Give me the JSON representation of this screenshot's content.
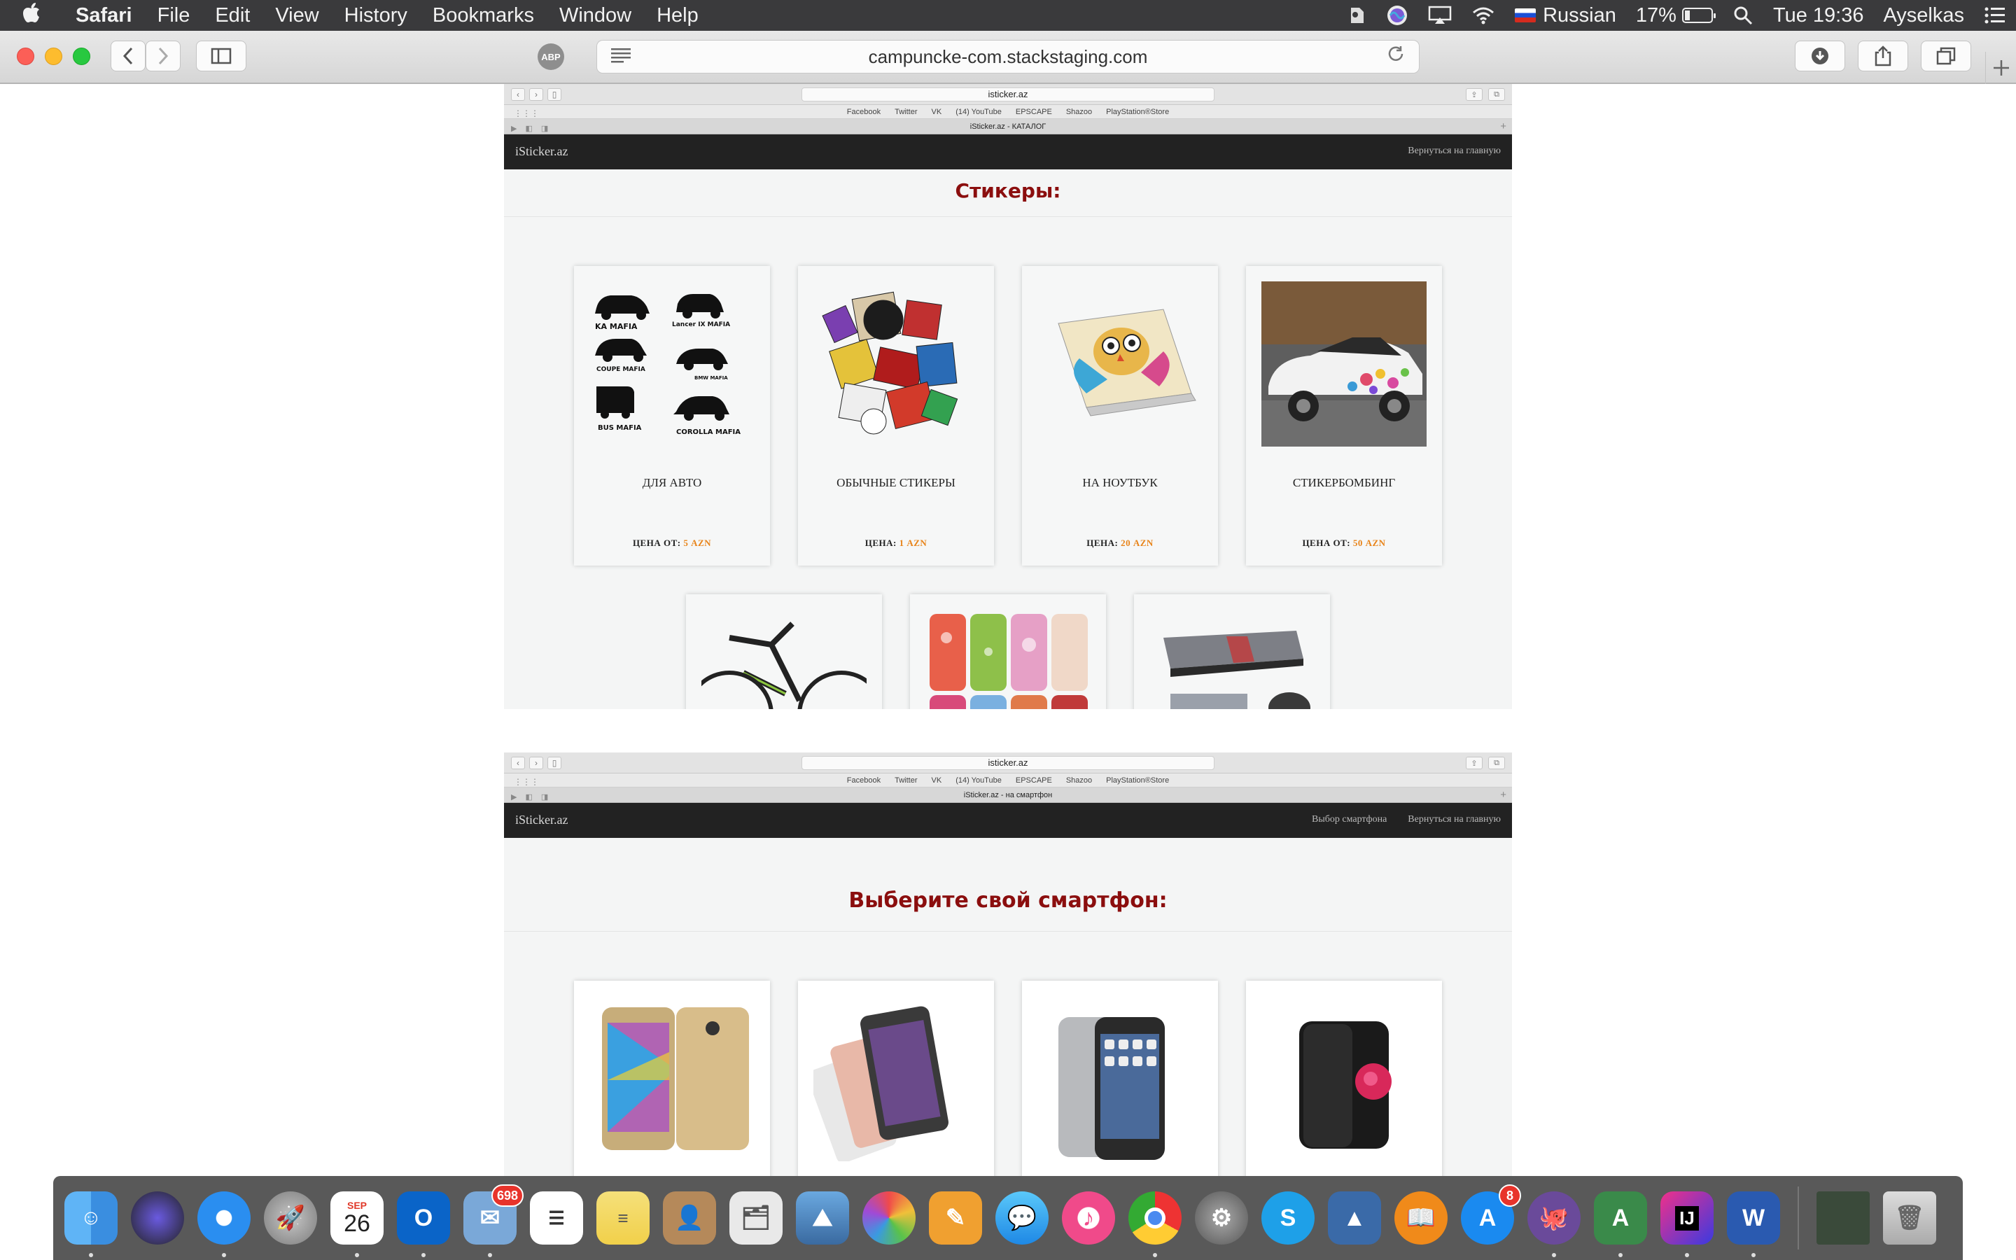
{
  "menubar": {
    "apple": "",
    "app": "Safari",
    "items": [
      "File",
      "Edit",
      "View",
      "History",
      "Bookmarks",
      "Window",
      "Help"
    ],
    "input_source": "Russian",
    "battery": "17%",
    "clock": "Tue 19:36",
    "user": "Ayselkas"
  },
  "browser": {
    "url": "campuncke-com.stackstaging.com",
    "abp_label": "ABP"
  },
  "shot1": {
    "mini_url": "isticker.az",
    "favorites": [
      "Facebook",
      "Twitter",
      "VK",
      "(14) YouTube",
      "EPSCAPE",
      "Shazoo",
      "PlayStation®Store"
    ],
    "tab_title": "iSticker.az - КАТАЛОГ",
    "brand": "iSticker.az",
    "nav_link": "Вернуться на главную",
    "heading": "Стикеры:",
    "cards": [
      {
        "title": "ДЛЯ АВТО",
        "price_label": "ЦЕНА ОТ:",
        "price_value": "5 AZN"
      },
      {
        "title": "ОБЫЧНЫЕ СТИКЕРЫ",
        "price_label": "ЦЕНА:",
        "price_value": "1 AZN"
      },
      {
        "title": "НА НОУТБУК",
        "price_label": "ЦЕНА:",
        "price_value": "20 AZN"
      },
      {
        "title": "СТИКЕРБОМБИНГ",
        "price_label": "ЦЕНА ОТ:",
        "price_value": "50 AZN"
      }
    ],
    "car_labels": [
      "KA MAFIA",
      "Lancer IX MAFIA",
      "COUPE MAFIA",
      "BMW MAFIA",
      "BUS MAFIA",
      "COROLLA MAFIA"
    ]
  },
  "shot2": {
    "mini_url": "isticker.az",
    "favorites": [
      "Facebook",
      "Twitter",
      "VK",
      "(14) YouTube",
      "EPSCAPE",
      "Shazoo",
      "PlayStation®Store"
    ],
    "tab_title": "iSticker.az - на смартфон",
    "brand": "iSticker.az",
    "nav_link_1": "Выбор смартфона",
    "nav_link_2": "Вернуться на главную",
    "heading": "Выберите свой смартфон:"
  },
  "dock": {
    "calendar_month": "SEP",
    "calendar_day": "26",
    "mail_badge": "698",
    "appstore_badge": "8"
  }
}
